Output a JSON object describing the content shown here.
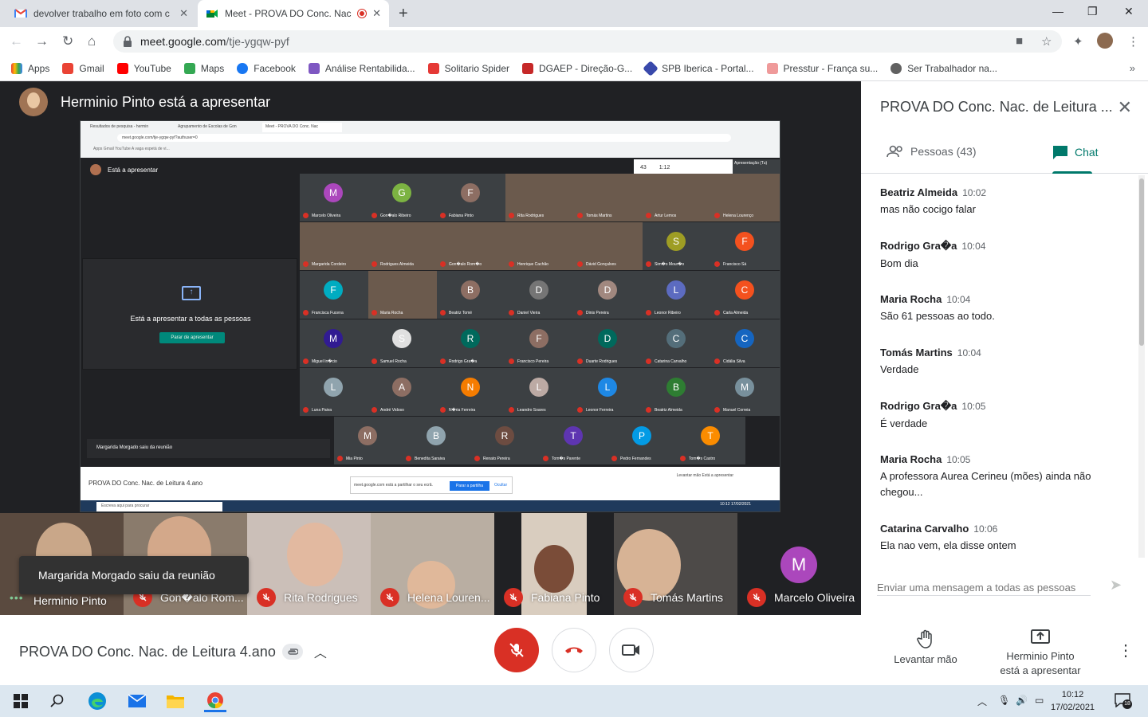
{
  "browser": {
    "tabs": [
      {
        "title": "devolver trabalho em foto com c",
        "active": false
      },
      {
        "title": "Meet - PROVA DO Conc. Nac",
        "active": true
      }
    ],
    "url_host": "meet.google.com",
    "url_path": "/tje-ygqw-pyf",
    "bookmarks": [
      "Apps",
      "Gmail",
      "YouTube",
      "Maps",
      "Facebook",
      "Análise Rentabilida...",
      "Solitario Spider",
      "DGAEP - Direção-G...",
      "SPB Iberica - Portal...",
      "Presstur - França su...",
      "Ser Trabalhador na..."
    ]
  },
  "stage": {
    "presenter_label": "Herminio Pinto está a apresentar",
    "toast": "Margarida Morgado saiu da reunião",
    "filmstrip": [
      {
        "name": "Herminio Pinto",
        "muted": false
      },
      {
        "name": "Gon�alo Rom...",
        "muted": true
      },
      {
        "name": "Rita Rodrigues",
        "muted": true
      },
      {
        "name": "Helena Louren...",
        "muted": true
      },
      {
        "name": "Fabiana Pinto",
        "muted": true
      },
      {
        "name": "Tomás Martins",
        "muted": true
      },
      {
        "name": "Marcelo Oliveira",
        "muted": true,
        "initial": "M"
      }
    ]
  },
  "shared_screen": {
    "tabs": [
      "Resultados de pesquisa - hermin",
      "Agrupamento de Escolas de Gon",
      "Meet - PROVA DO Conc. Nac"
    ],
    "url": "meet.google.com/tje-ygqw-pyf?authuser=0",
    "bookmarks": "Apps   Gmail   YouTube   A vaga espetá de vi...",
    "presenting_label": "Está a apresentar",
    "present_all": "Está a apresentar a todas as pessoas",
    "stop_button": "Parar de apresentar",
    "left_note": "Margarida Morgado saiu da reunião",
    "topright": {
      "count": "43",
      "time": "1:12",
      "preview": "Apresentação (Tu)"
    },
    "participants": [
      {
        "name": "Marcelo Oliveira",
        "initial": "M",
        "color": "#ab47bc"
      },
      {
        "name": "Gon�alo Ribeiro",
        "initial": "G",
        "color": "#7cb342"
      },
      {
        "name": "Fabiana Pinto",
        "initial": "F",
        "color": "#8d6e63"
      },
      {
        "name": "Rita Rodrigues",
        "cam": true
      },
      {
        "name": "Tomás Martins",
        "cam": true
      },
      {
        "name": "Artur Lemos",
        "cam": true
      },
      {
        "name": "Helena Lourenço",
        "cam": true
      },
      {
        "name": "Margarida Cordeiro",
        "cam": true
      },
      {
        "name": "Rodrigues Almeida",
        "cam": true
      },
      {
        "name": "Gon�alo Rom�o",
        "cam": true
      },
      {
        "name": "Henrique Cachão",
        "cam": true
      },
      {
        "name": "Dávid Gonçalves",
        "cam": true
      },
      {
        "name": "Sim�o Mour�o",
        "cam": false,
        "initial": "S",
        "color": "#9e9d24"
      },
      {
        "name": "Francisco Sá",
        "cam": false,
        "initial": "F",
        "color": "#f4511e"
      },
      {
        "name": "Francisca Fucena",
        "initial": "F",
        "color": "#00acc1"
      },
      {
        "name": "Maria Rocha",
        "cam": true
      },
      {
        "name": "Beatriz Tomé",
        "initial": "B",
        "color": "#8d6e63"
      },
      {
        "name": "Daniel Vieira",
        "initial": "D",
        "color": "#757575"
      },
      {
        "name": "Dinis Pereira",
        "initial": "D",
        "color": "#a1887f"
      },
      {
        "name": "Leonor Ribeiro",
        "initial": "L",
        "color": "#5c6bc0"
      },
      {
        "name": "Carla Almeida",
        "initial": "C",
        "color": "#f4511e"
      },
      {
        "name": "Miguel In�cio",
        "initial": "M",
        "color": "#311b92"
      },
      {
        "name": "Samuel Rocha",
        "initial": "S",
        "color": "#e0e0e0"
      },
      {
        "name": "Rodrigo Gra�a",
        "initial": "R",
        "color": "#00695c"
      },
      {
        "name": "Francisco Pereira",
        "initial": "F",
        "color": "#8d6e63"
      },
      {
        "name": "Duarte Rodrigues",
        "initial": "D",
        "color": "#00695c"
      },
      {
        "name": "Catarina Carvalho",
        "initial": "C",
        "color": "#546e7a"
      },
      {
        "name": "Cidália Silva",
        "initial": "C",
        "color": "#1565c0"
      },
      {
        "name": "Luna Paiva",
        "initial": "L",
        "color": "#90a4ae"
      },
      {
        "name": "André Vidoso",
        "initial": "A",
        "color": "#8d6e63"
      },
      {
        "name": "N�ria Ferreira",
        "initial": "N",
        "color": "#f57c00"
      },
      {
        "name": "Leandro Soares",
        "initial": "L",
        "color": "#bcaaa4"
      },
      {
        "name": "Leonor Ferreira",
        "initial": "L",
        "color": "#1e88e5"
      },
      {
        "name": "Beatriz Almeida",
        "initial": "B",
        "color": "#2e7d32"
      },
      {
        "name": "Manuel Correia",
        "initial": "M",
        "color": "#78909c"
      },
      {
        "name": "Mia Pinto",
        "initial": "M",
        "color": "#8d6e63"
      },
      {
        "name": "Benedita Saraiva",
        "initial": "B",
        "color": "#90a4ae"
      },
      {
        "name": "Renato Pereira",
        "initial": "R",
        "color": "#6d4c41"
      },
      {
        "name": "Tom�s Parente",
        "initial": "T",
        "color": "#5e35b1"
      },
      {
        "name": "Pedro Fernandes",
        "initial": "P",
        "color": "#039be5"
      },
      {
        "name": "Tom�s Castro",
        "initial": "T",
        "color": "#fb8c00"
      }
    ],
    "bottom_title": "PROVA DO Conc. Nac. de Leitura 4.ano",
    "share_note": "meet.google.com está a partilhar o seu ecrã.",
    "share_button": "Parar a partilha",
    "hide_button": "Ocultar",
    "bottom_right": "Levantar mão     Está a apresentar",
    "taskbar_search": "Escreva aqui para procurar",
    "taskbar_time": "10:12  17/02/2021"
  },
  "panel": {
    "title": "PROVA DO Conc. Nac. de Leitura ...",
    "people_tab": "Pessoas (43)",
    "chat_tab": "Chat",
    "messages": [
      {
        "sender": "Beatriz Almeida",
        "time": "10:02",
        "text": "mas não cocigo falar"
      },
      {
        "sender": "Rodrigo Gra�a",
        "time": "10:04",
        "text": "Bom dia"
      },
      {
        "sender": "Maria Rocha",
        "time": "10:04",
        "text": "São 61 pessoas ao todo."
      },
      {
        "sender": "Tomás Martins",
        "time": "10:04",
        "text": "Verdade"
      },
      {
        "sender": "Rodrigo Gra�a",
        "time": "10:05",
        "text": "É verdade"
      },
      {
        "sender": "Maria Rocha",
        "time": "10:05",
        "text": "A professora Aurea Cerineu (mões) ainda não chegou..."
      },
      {
        "sender": "Catarina Carvalho",
        "time": "10:06",
        "text": "Ela nao vem, ela disse ontem"
      }
    ],
    "input_placeholder": "Enviar uma mensagem a todas as pessoas"
  },
  "bottombar": {
    "meeting_title": "PROVA DO Conc. Nac. de Leitura 4.ano",
    "raise_hand": "Levantar mão",
    "presenting_line1": "Herminio Pinto",
    "presenting_line2": "está a apresentar"
  },
  "taskbar": {
    "time": "10:12",
    "date": "17/02/2021",
    "notifications": "18"
  },
  "colors": {
    "meet_dark": "#202124",
    "accent_teal": "#00796b",
    "danger_red": "#d93025"
  }
}
